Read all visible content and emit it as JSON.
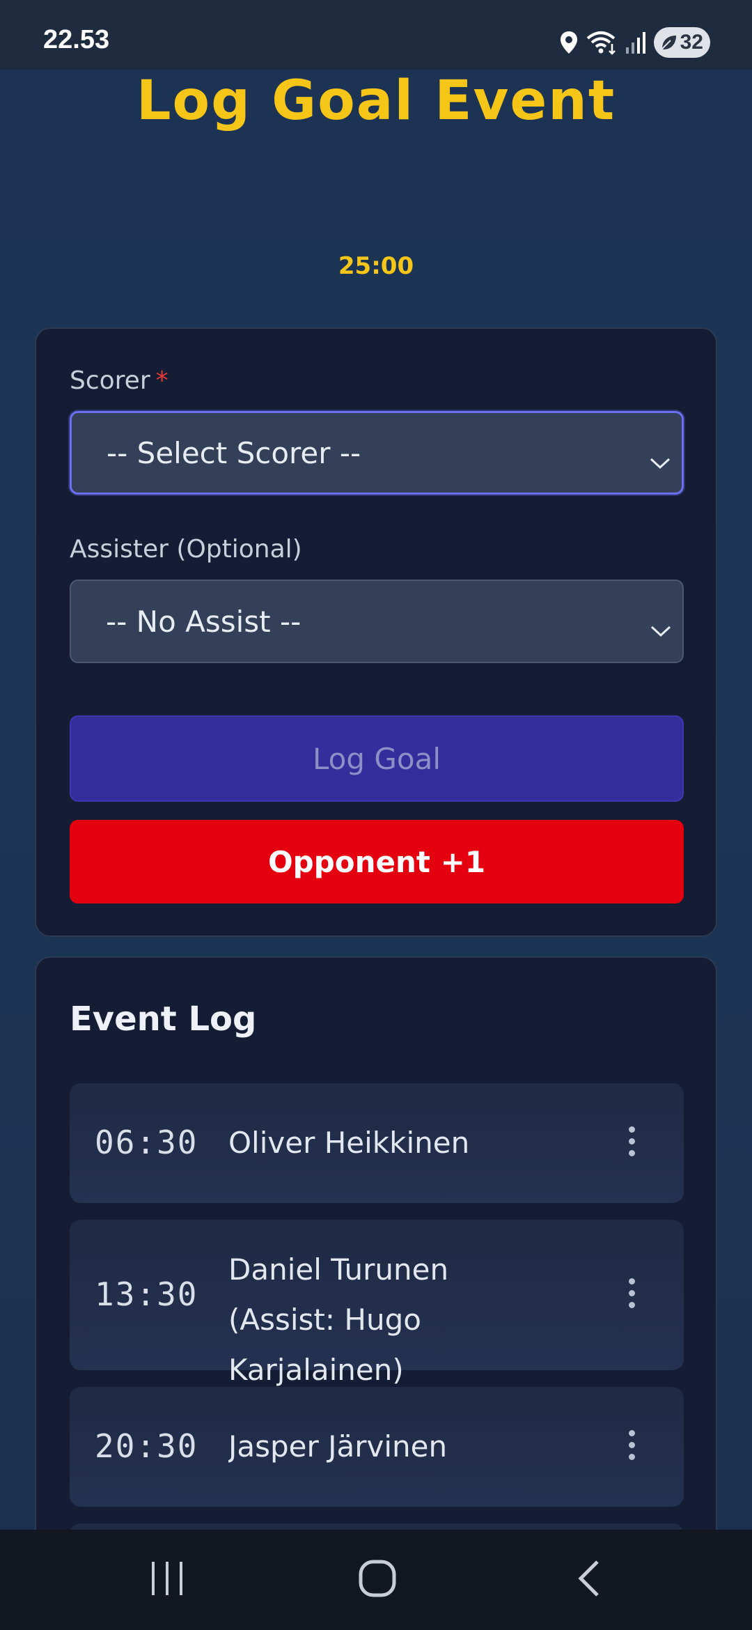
{
  "status_bar": {
    "time": "22.53",
    "battery": "32",
    "icons": [
      "location-icon",
      "wifi-icon",
      "signal-icon",
      "battery-saver-icon"
    ]
  },
  "header": {
    "title": "Log Goal Event",
    "timer": "25:00"
  },
  "form": {
    "scorer_label": "Scorer",
    "required_mark": "*",
    "scorer_value": "-- Select Scorer --",
    "assister_label": "Assister (Optional)",
    "assister_value": "-- No Assist --",
    "log_goal_label": "Log Goal",
    "opponent_label": "Opponent +1"
  },
  "event_log": {
    "title": "Event Log",
    "events": [
      {
        "time": "06:30",
        "description": "Oliver Heikkinen"
      },
      {
        "time": "13:30",
        "description": "Daniel Turunen (Assist: Hugo Karjalainen)"
      },
      {
        "time": "20:30",
        "description": "Jasper Järvinen"
      }
    ]
  },
  "colors": {
    "accent_yellow": "#f5c518",
    "primary_indigo": "#342d9c",
    "danger_red": "#e5000f"
  },
  "nav_bar": {
    "icons": [
      "recent-apps-icon",
      "home-icon",
      "back-icon"
    ]
  }
}
